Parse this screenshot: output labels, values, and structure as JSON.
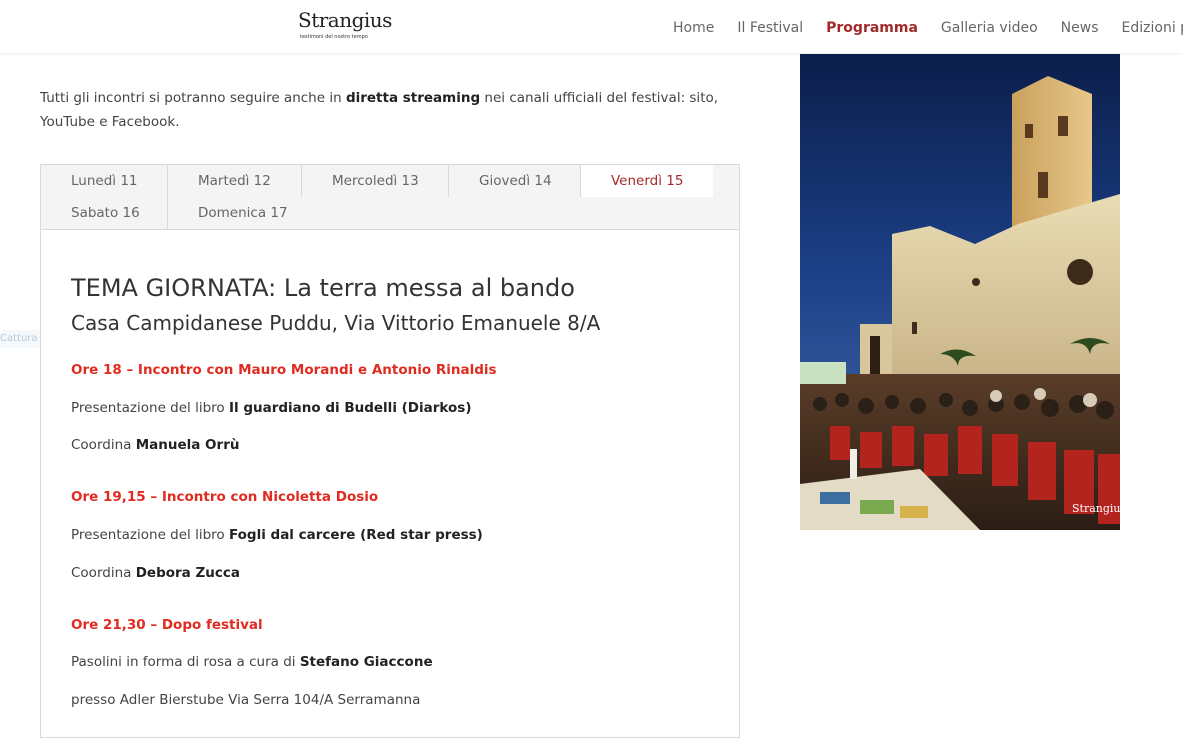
{
  "header": {
    "logo_text": "Strangius",
    "logo_subtitle": "testimoni del nostro tempo",
    "nav": [
      "Home",
      "Il Festival",
      "Programma",
      "Galleria video",
      "News",
      "Edizioni pa"
    ]
  },
  "intro": {
    "part1": "Tutti gli incontri si potranno seguire anche in ",
    "bold": "diretta streaming",
    "part2": " nei canali ufficiali del festival: sito, YouTube e Facebook."
  },
  "tabs": [
    "Lunedì 11",
    "Martedì 12",
    "Mercoledì 13",
    "Giovedì 14",
    "Venerdì 15",
    "Sabato 16",
    "Domenica 17"
  ],
  "active_tab": "Venerdì 15",
  "ghost_text": "Cattura schermo intero",
  "content": {
    "theme": "TEMA GIORNATA: La terra messa al bando",
    "place": "Casa Campidanese Puddu, Via Vittorio Emanuele 8/A",
    "events": [
      {
        "title": "Ore 18 – Incontro con Mauro Morandi e Antonio Rinaldis",
        "book_prefix": "Presentazione del libro ",
        "book": "Il guardiano di Budelli (Diarkos)",
        "coord_prefix": "Coordina ",
        "coord": "Manuela Orrù"
      },
      {
        "title": "Ore 19,15 – Incontro con Nicoletta Dosio",
        "book_prefix": "Presentazione del libro ",
        "book": "Fogli dal carcere (Red star press)",
        "coord_prefix": "Coordina ",
        "coord": "Debora Zucca"
      },
      {
        "title": "Ore 21,30 – Dopo festival",
        "line1_prefix": "Pasolini in forma di rosa a cura di ",
        "line1_bold": "Stefano Giaccone",
        "line2": "presso Adler Bierstube Via Serra 104/A Serramanna"
      }
    ]
  },
  "photo": {
    "watermark": "Strangius"
  }
}
